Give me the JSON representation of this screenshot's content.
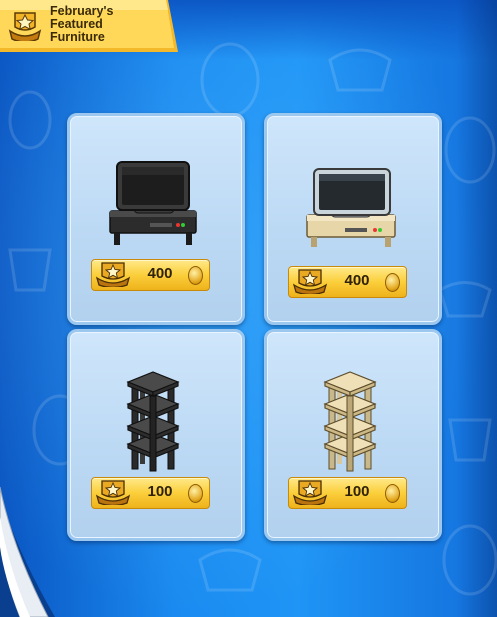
{
  "banner": {
    "title_line1": "February's",
    "title_line2": "Featured",
    "title_line3": "Furniture",
    "icon": "membership-badge-icon"
  },
  "items": [
    {
      "name": "black-tv",
      "price": "400",
      "currency_icon": "coin-icon",
      "badge_icon": "member-star-badge-icon"
    },
    {
      "name": "beige-tv",
      "price": "400",
      "currency_icon": "coin-icon",
      "badge_icon": "member-star-badge-icon"
    },
    {
      "name": "black-shelf",
      "price": "100",
      "currency_icon": "coin-icon",
      "badge_icon": "member-star-badge-icon"
    },
    {
      "name": "beige-shelf",
      "price": "100",
      "currency_icon": "coin-icon",
      "badge_icon": "member-star-badge-icon"
    }
  ],
  "colors": {
    "background": "#1a8af0",
    "card": "#c5def6",
    "price_tag": "#fbcf3b",
    "banner": "#ffd24a"
  }
}
